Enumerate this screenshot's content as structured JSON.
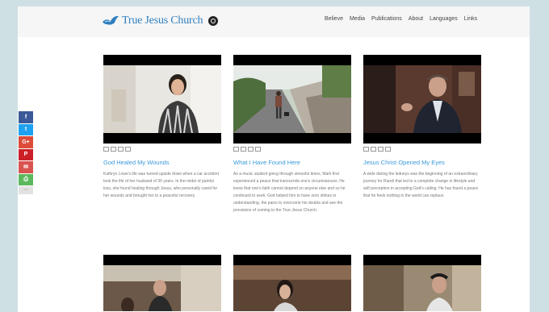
{
  "site": {
    "logo_text": "True Jesus Church",
    "nav": [
      "Believe",
      "Media",
      "Publications",
      "About",
      "Languages",
      "Links"
    ]
  },
  "social": [
    {
      "glyph": "f",
      "color": "#3b5998"
    },
    {
      "glyph": "t",
      "color": "#1da1f2"
    },
    {
      "glyph": "G+",
      "color": "#dd4b39"
    },
    {
      "glyph": "P",
      "color": "#cb2027"
    },
    {
      "glyph": "✉",
      "color": "#d9534f"
    },
    {
      "glyph": "⎙",
      "color": "#5cb85c"
    },
    {
      "glyph": "···",
      "color": "#e2e2e2"
    }
  ],
  "cards": [
    {
      "title": "God Healed My Wounds",
      "description": "Kathryn Lowe's life was turned upside down when a car accident took the life of her husband of 30 years. In the midst of painful loss, she found healing through Jesus, who personally cared for her wounds and brought her to a peaceful recovery."
    },
    {
      "title": "What I Have Found Here",
      "description": "As a music student going through stressful times, Mark first experienced a peace that transcends one's circumstances. He knew that one's faith cannot depend on anyone else and so he continued to seek. God helped him to have zero strikes in understanding, the pains to overcome his doubts and see the provisions of coming to the True Jesus Church."
    },
    {
      "title": "Jesus Christ Opened My Eyes",
      "description": "A wide daring the kidneys was the beginning of an extraordinary journey for Randi that led to a complete change in lifestyle and self perception in accepting God's calling. He has found a peace that he feels nothing in the world can replace."
    }
  ]
}
